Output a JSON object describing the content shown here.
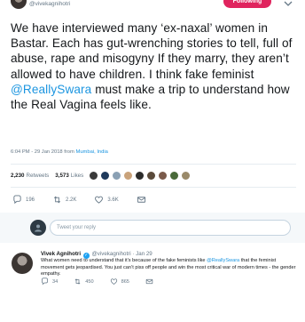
{
  "header": {
    "handle": "@vivekagnihotri",
    "follow_label": "Following"
  },
  "tweet": {
    "text_before": "We have interviewed many ‘ex-naxal’ women in Bastar. Each has gut-wrenching stories to tell, full of abuse, rape and misogyny If they marry, they aren’t allowed to have children. I think fake feminist ",
    "mention": "@ReallySwara",
    "text_after": " must make a trip to understand how the Real Vagina feels like.",
    "timestamp": "6:04 PM - 29 Jan 2018 from",
    "location": "Mumbai, India",
    "retweets_count": "2,230",
    "retweets_label": "Retweets",
    "likes_count": "3,573",
    "likes_label": "Likes",
    "liker_colors": [
      "#3a3a3a",
      "#1f3a5c",
      "#8aa0b4",
      "#c9a27a",
      "#2b2b2b",
      "#5a4a3a",
      "#7a5a4a",
      "#4a6a3a",
      "#9a8a6a"
    ],
    "actions": {
      "reply_count": "196",
      "retweet_count": "2.2K",
      "like_count": "3.6K"
    }
  },
  "reply_box": {
    "placeholder": "Tweet your reply"
  },
  "reply": {
    "name": "Vivek Agnihotri",
    "handle": "@vivekagnihotri",
    "date": "· Jan 29",
    "text_before": "What women need to understand that it’s because of the fake feminists like ",
    "mention": "@ReallySwara",
    "text_after": " that the feminist movement gets jeopardised. You just can’t piss off people and win the most critical war of modern times - the gender empathy.",
    "reply_count": "34",
    "retweet_count": "450",
    "like_count": "865"
  },
  "colors": {
    "accent": "#1b95e0",
    "follow_bg": "#e0245e",
    "muted": "#657786"
  }
}
